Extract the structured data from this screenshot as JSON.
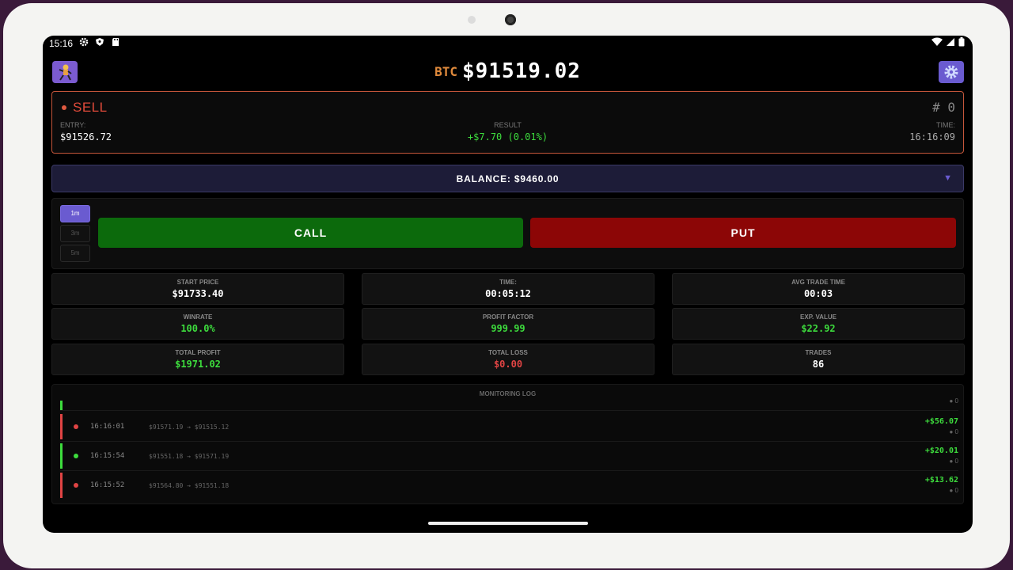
{
  "status_bar": {
    "time": "15:16"
  },
  "header": {
    "symbol": "BTC",
    "price": "$91519.02"
  },
  "signal": {
    "direction": "SELL",
    "number": "# 0",
    "entry_label": "ENTRY:",
    "entry_value": "$91526.72",
    "result_label": "RESULT",
    "result_value": "+$7.70 (0.01%)",
    "time_label": "TIME:",
    "time_value": "16:16:09"
  },
  "balance": {
    "text": "BALANCE: $9460.00"
  },
  "timeframes": [
    "1m",
    "3m",
    "5m"
  ],
  "actions": {
    "call": "CALL",
    "put": "PUT"
  },
  "stats": [
    {
      "label": "START PRICE",
      "value": "$91733.40"
    },
    {
      "label": "TIME:",
      "value": "00:05:12"
    },
    {
      "label": "AVG TRADE TIME",
      "value": "00:03"
    },
    {
      "label": "WINRATE",
      "value": "100.0%"
    },
    {
      "label": "PROFIT FACTOR",
      "value": "999.99"
    },
    {
      "label": "EXP. VALUE",
      "value": "$22.92"
    },
    {
      "label": "TOTAL PROFIT",
      "value": "$1971.02"
    },
    {
      "label": "TOTAL LOSS",
      "value": "$0.00"
    },
    {
      "label": "TRADES",
      "value": "86"
    }
  ],
  "log": {
    "title": "MONITORING LOG",
    "partial_sub": "● 0",
    "rows": [
      {
        "time": "16:16:01",
        "prices": "$91571.19 → $91515.12",
        "profit": "+$56.07",
        "sub": "● 0",
        "color": "#e04444"
      },
      {
        "time": "16:15:54",
        "prices": "$91551.18 → $91571.19",
        "profit": "+$20.01",
        "sub": "● 0",
        "color": "#3ddc3d"
      },
      {
        "time": "16:15:52",
        "prices": "$91564.80 → $91551.18",
        "profit": "+$13.62",
        "sub": "● 0",
        "color": "#e04444"
      }
    ]
  },
  "colors": {
    "accent": "#6a5bd0",
    "buy": "#0c6a0c",
    "sell": "#8c0606",
    "profit": "#3ddc3d",
    "loss": "#e04444",
    "symbol": "#e08a3c"
  },
  "icons": [
    "gear-icon",
    "shield-icon",
    "sd-card-icon",
    "wifi-icon",
    "signal-icon",
    "battery-icon",
    "app-logo",
    "settings-gear-icon",
    "dropdown-arrow-icon"
  ]
}
